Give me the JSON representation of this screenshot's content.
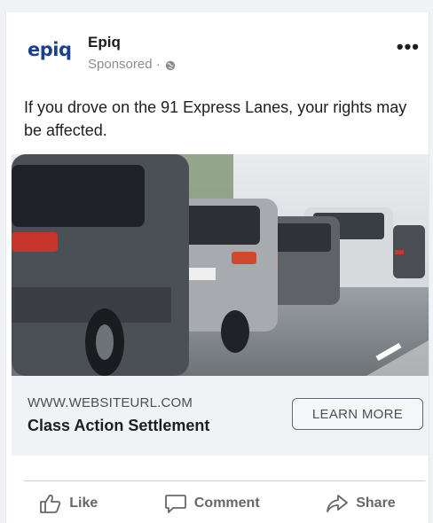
{
  "post": {
    "advertiser_logo": "epiq",
    "advertiser_name": "Epiq",
    "sponsored_label": "Sponsored ·",
    "privacy_icon": "globe-icon",
    "more_options_icon": "more-horizontal-icon",
    "text": "If you drove on the 91 Express Lanes, your rights may be affected."
  },
  "ad": {
    "image_description_icon": "traffic-photo",
    "display_url": "WWW.WEBSITEURL.COM",
    "headline": "Class Action Settlement",
    "cta_label": "LEARN MORE"
  },
  "actions": [
    {
      "label": "Like",
      "icon": "thumbs-up-icon"
    },
    {
      "label": "Comment",
      "icon": "comment-icon"
    },
    {
      "label": "Share",
      "icon": "share-icon"
    }
  ],
  "colors": {
    "logo_dark": "#1c3f8e",
    "logo_light": "#1e8ad6",
    "cta_bar": "#f0f2f5",
    "muted_text": "#65676b"
  }
}
